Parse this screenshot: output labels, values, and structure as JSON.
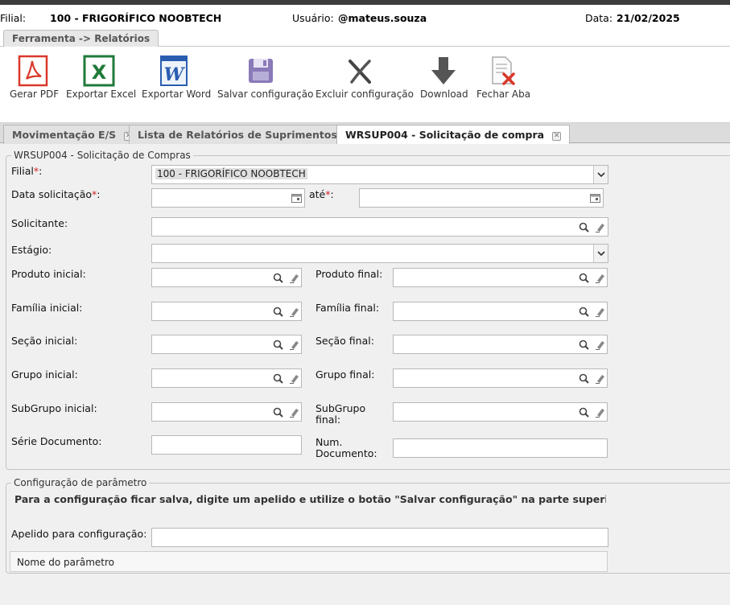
{
  "header": {
    "filial_label": "Filial:",
    "filial_value": "100 - FRIGORÍFICO NOOBTECH",
    "user_label": "Usuário:",
    "user_value": "@mateus.souza",
    "date_label": "Data:",
    "date_value": "21/02/2025"
  },
  "breadcrumb": {
    "label": "Ferramenta -> Relatórios"
  },
  "toolbar": {
    "pdf": "Gerar PDF",
    "excel": "Exportar Excel",
    "word": "Exportar Word",
    "save": "Salvar configuração",
    "delete": "Excluir configuração",
    "download": "Download",
    "close_tab": "Fechar Aba"
  },
  "tabs": [
    {
      "label": "Movimentação E/S"
    },
    {
      "label": "Lista de Relatórios de Suprimentos"
    },
    {
      "label": "WRSUP004 - Solicitação de compra"
    }
  ],
  "form": {
    "legend": "WRSUP004 - Solicitação de Compras",
    "filial_label": "Filial",
    "filial_value": "100 - FRIGORÍFICO NOOBTECH",
    "data_label": "Data solicitação",
    "ate_label": "até",
    "solicitante_label": "Solicitante:",
    "estagio_label": "Estágio:",
    "produto_inicial": "Produto inicial:",
    "produto_final": "Produto final:",
    "familia_inicial": "Família inicial:",
    "familia_final": "Família final:",
    "secao_inicial": "Seção inicial:",
    "secao_final": "Seção final:",
    "grupo_inicial": "Grupo inicial:",
    "grupo_final": "Grupo final:",
    "subgrupo_inicial": "SubGrupo inicial:",
    "subgrupo_final_1": "SubGrupo",
    "subgrupo_final_2": "final:",
    "serie_documento": "Série Documento:",
    "num_documento_1": "Num.",
    "num_documento_2": "Documento:",
    "required_mark": "*",
    "colon": ":"
  },
  "params": {
    "legend": "Configuração de parâmetro",
    "info": "Para a configuração ficar salva, digite um apelido e utilize o botão \"Salvar configuração\" na parte superior da tela. O ap",
    "apelido_label": "Apelido para configuração:",
    "grid_header": "Nome do parâmetro"
  },
  "colors": {
    "pdf_red": "#d9382b",
    "excel_green": "#1f7a3a",
    "word_blue": "#2a5db0",
    "save_purple": "#8a7ab8",
    "required": "#d42020"
  }
}
